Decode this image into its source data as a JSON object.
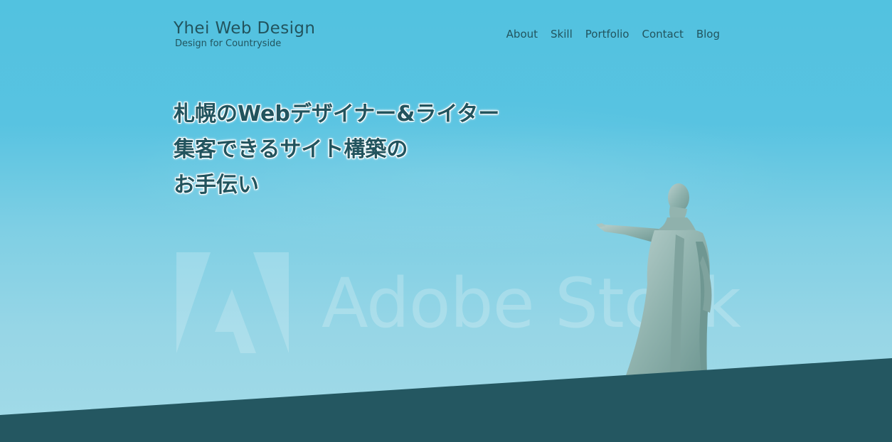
{
  "header": {
    "logo_title": "Yhei Web Design",
    "logo_subtitle": "Design for Countryside"
  },
  "nav": {
    "items": [
      {
        "label": "About"
      },
      {
        "label": "Skill"
      },
      {
        "label": "Portfolio"
      },
      {
        "label": "Contact"
      },
      {
        "label": "Blog"
      }
    ]
  },
  "hero": {
    "headline_lines": [
      "札幌のWebデザイナー&ライター",
      "集客できるサイト構築の",
      "お手伝い"
    ],
    "watermark_text": "Adobe Stock"
  },
  "colors": {
    "text_dark_teal": "#22545e",
    "band_dark_teal": "#245761",
    "sky_top": "#52c2e0",
    "sky_bottom": "#a3dbe8"
  }
}
